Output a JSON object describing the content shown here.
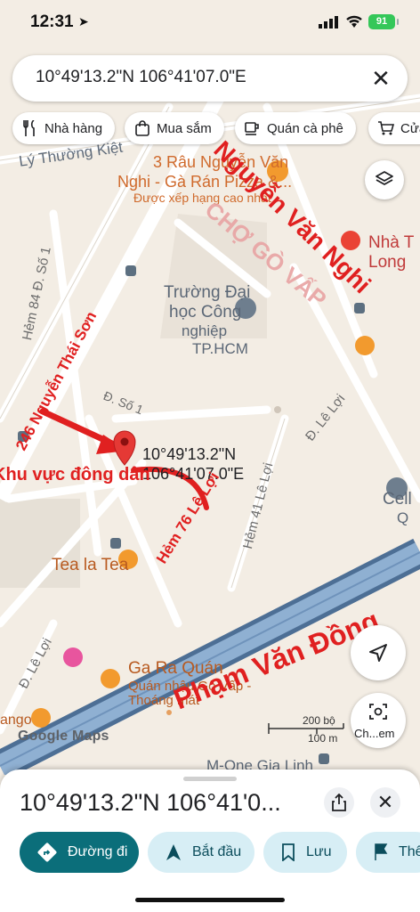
{
  "status_bar": {
    "time": "12:31",
    "battery": "91"
  },
  "search": {
    "query": "10°49'13.2\"N 106°41'07.0\"E",
    "clear_icon": "close-icon"
  },
  "chips": [
    {
      "label": "Nhà hàng",
      "icon": "restaurant-icon"
    },
    {
      "label": "Mua sắm",
      "icon": "shopping-bag-icon"
    },
    {
      "label": "Quán cà phê",
      "icon": "coffee-icon"
    },
    {
      "label": "Cửa",
      "icon": "cart-icon"
    }
  ],
  "map": {
    "streets": {
      "ly_thuong_kiet": "Lý Thường Kiệt",
      "hem_84": "Hẻm 84 Đ. Số 1",
      "d_so_1_a": "Đ. Số 1",
      "d_so_1_b": "Đ. Số 1",
      "le_loi_a": "Đ. Lê Lợi",
      "le_loi_b": "Đ. Lê Lợi",
      "hem_41": "Hẻm 41 Lê Lợi"
    },
    "places": {
      "rau_pizza_1": "3 Râu Nguyễn Văn",
      "rau_pizza_2": "Nghi - Gà Rán Pizza &...",
      "rau_pizza_3": "Được xếp hạng cao nhất",
      "nha_long_1": "Nhà T",
      "nha_long_2": "Long",
      "truong_1": "Trường Đại",
      "truong_2": "học Công",
      "truong_3": "nghiệp",
      "truong_4": "TP.HCM",
      "tea_la_tea": "Tea la Tea",
      "ga_ra_quan": "Ga Ra Quán",
      "quan_nhau_1": "Quán nhậu Gò Vấp -",
      "quan_nhau_2": "Thoáng mát",
      "cell_1": "Cell",
      "cell_2": "Q",
      "m_one": "M-One Gia Linh",
      "ango": "ango"
    },
    "pin_label_1": "10°49'13.2\"N",
    "pin_label_2": "106°41'07.0\"E",
    "annotations": {
      "nguyen_van_nghi": "Nguyễn Văn Nghi",
      "cho_go_vap": "CHỢ GÒ VẤP",
      "nguyen_thai_son": "246 Nguyễn Thái Sơn",
      "khu_vuc": "Khu vực đông dân",
      "hem_76": "Hẻm 76 Lê Lợi",
      "pham_van_dong": "Phạm Văn Đồng"
    },
    "annotation_color": "#e02020"
  },
  "scale": {
    "top": "200 bộ",
    "bottom": "100 m"
  },
  "branding": "Google Maps",
  "lens_label": "Ch...em",
  "sheet": {
    "title": "10°49'13.2\"N 106°41'0...",
    "buttons": [
      {
        "label": "Đường đi",
        "icon": "directions-icon"
      },
      {
        "label": "Bắt đầu",
        "icon": "navigation-icon"
      },
      {
        "label": "Lưu",
        "icon": "bookmark-icon"
      },
      {
        "label": "Thê",
        "icon": "flag-icon"
      }
    ]
  },
  "colors": {
    "primary_button": "#0b6e7a",
    "secondary_button": "#d7eef5",
    "highway": "#5a7fa6",
    "pin": "#e53935"
  }
}
